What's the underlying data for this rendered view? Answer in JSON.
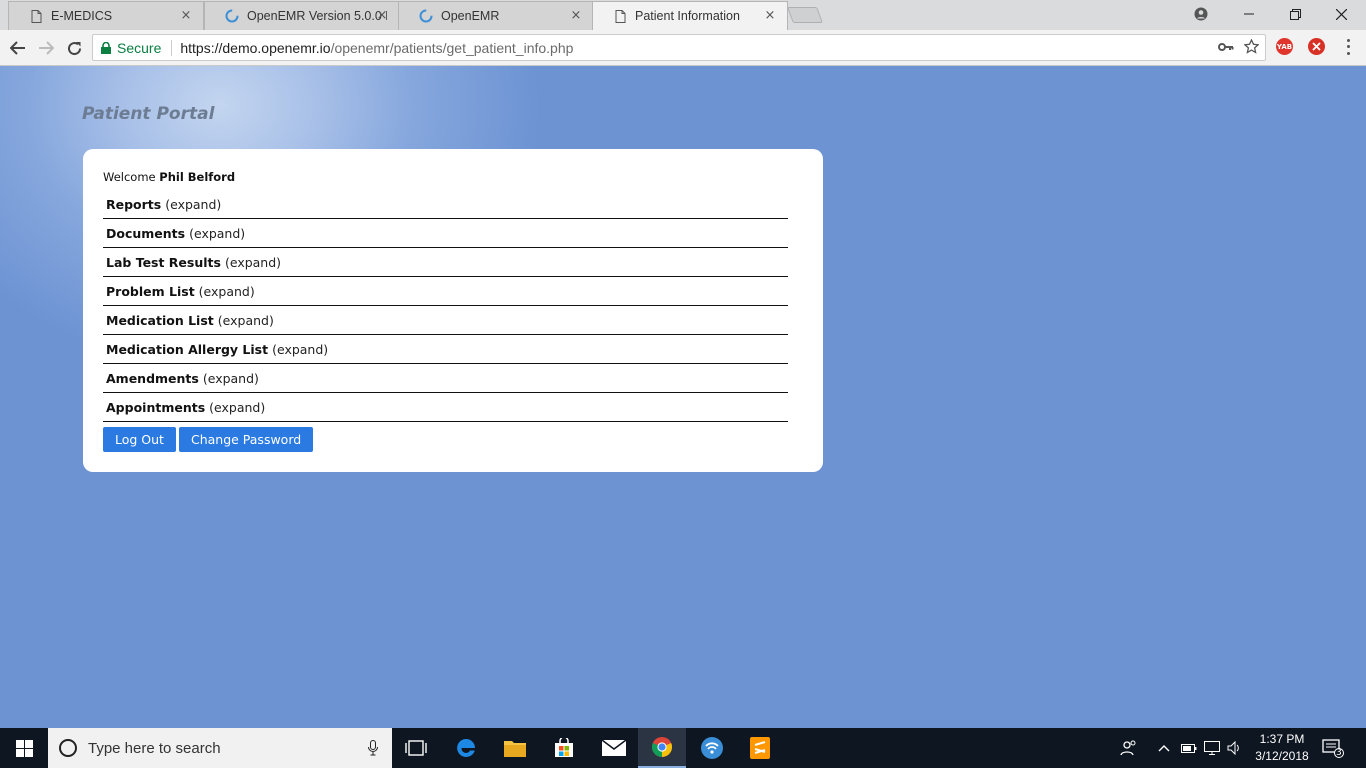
{
  "browser": {
    "tabs": [
      {
        "title": "E-MEDICS",
        "icon": "page-icon"
      },
      {
        "title": "OpenEMR Version 5.0.0 D",
        "icon": "openemr-icon"
      },
      {
        "title": "OpenEMR",
        "icon": "openemr-icon"
      },
      {
        "title": "Patient Information",
        "icon": "page-icon",
        "active": true
      }
    ],
    "close_glyph": "×",
    "secure_label": "Secure",
    "url_host": "https://demo.openemr.io",
    "url_path": "/openemr/patients/get_patient_info.php",
    "extension_yab_label": "YAB"
  },
  "portal": {
    "title": "Patient Portal",
    "welcome_prefix": "Welcome",
    "patient_name": "Phil Belford",
    "sections": [
      {
        "title": "Reports",
        "expand": "(expand)"
      },
      {
        "title": "Documents",
        "expand": "(expand)"
      },
      {
        "title": "Lab Test Results",
        "expand": "(expand)"
      },
      {
        "title": "Problem List",
        "expand": "(expand)"
      },
      {
        "title": "Medication List",
        "expand": "(expand)"
      },
      {
        "title": "Medication Allergy List",
        "expand": "(expand)"
      },
      {
        "title": "Amendments",
        "expand": "(expand)"
      },
      {
        "title": "Appointments",
        "expand": "(expand)"
      }
    ],
    "logout_label": "Log Out",
    "change_password_label": "Change Password"
  },
  "taskbar": {
    "search_placeholder": "Type here to search",
    "time": "1:37 PM",
    "date": "3/12/2018",
    "notification_count": "3"
  },
  "colors": {
    "page_background": "#6891d3",
    "button": "#2a7ae2",
    "secure_green": "#0b8043",
    "taskbar": "#0e1621"
  }
}
